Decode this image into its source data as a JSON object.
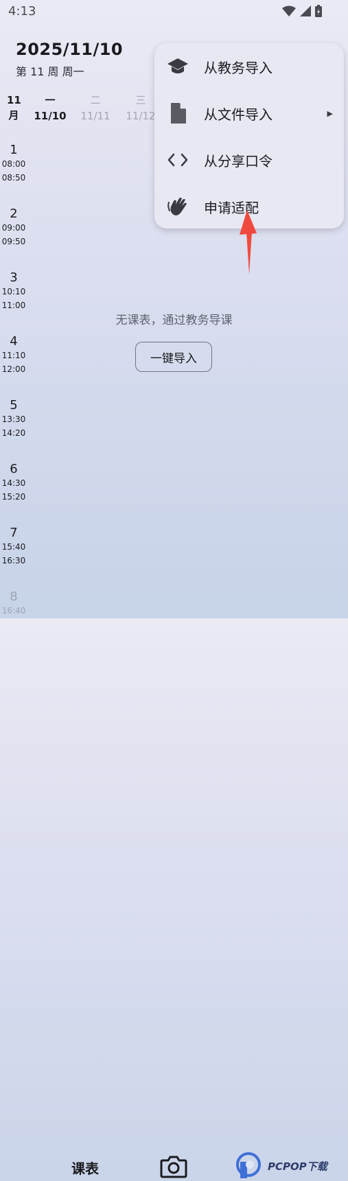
{
  "status": {
    "time": "4:13"
  },
  "header": {
    "date": "2025/11/10",
    "week": "第 11 周  周一"
  },
  "month": {
    "top": "11",
    "bottom": "月"
  },
  "days": [
    {
      "name": "一",
      "date": "11/10"
    },
    {
      "name": "二",
      "date": "11/11"
    },
    {
      "name": "三",
      "date": "11/12"
    }
  ],
  "periods": [
    {
      "num": "1",
      "start": "08:00",
      "end": "08:50"
    },
    {
      "num": "2",
      "start": "09:00",
      "end": "09:50"
    },
    {
      "num": "3",
      "start": "10:10",
      "end": "11:00"
    },
    {
      "num": "4",
      "start": "11:10",
      "end": "12:00"
    },
    {
      "num": "5",
      "start": "13:30",
      "end": "14:20"
    },
    {
      "num": "6",
      "start": "14:30",
      "end": "15:20"
    },
    {
      "num": "7",
      "start": "15:40",
      "end": "16:30"
    },
    {
      "num": "8",
      "start": "16:40",
      "end": ""
    }
  ],
  "empty": {
    "message": "无课表，通过教务导课",
    "button": "一键导入"
  },
  "menu": {
    "items": [
      {
        "label": "从教务导入",
        "icon": "graduation-cap-icon"
      },
      {
        "label": "从文件导入",
        "icon": "file-icon"
      },
      {
        "label": "从分享口令",
        "icon": "code-icon"
      },
      {
        "label": "申请适配",
        "icon": "waving-hand-icon"
      }
    ]
  },
  "nav": {
    "schedule": "课表"
  },
  "watermark": {
    "text": "PCPOP下载"
  },
  "colors": {
    "annotation": "#f04a3e",
    "background_top": "#eaeaf4",
    "background_bottom": "#c7d3e8"
  }
}
